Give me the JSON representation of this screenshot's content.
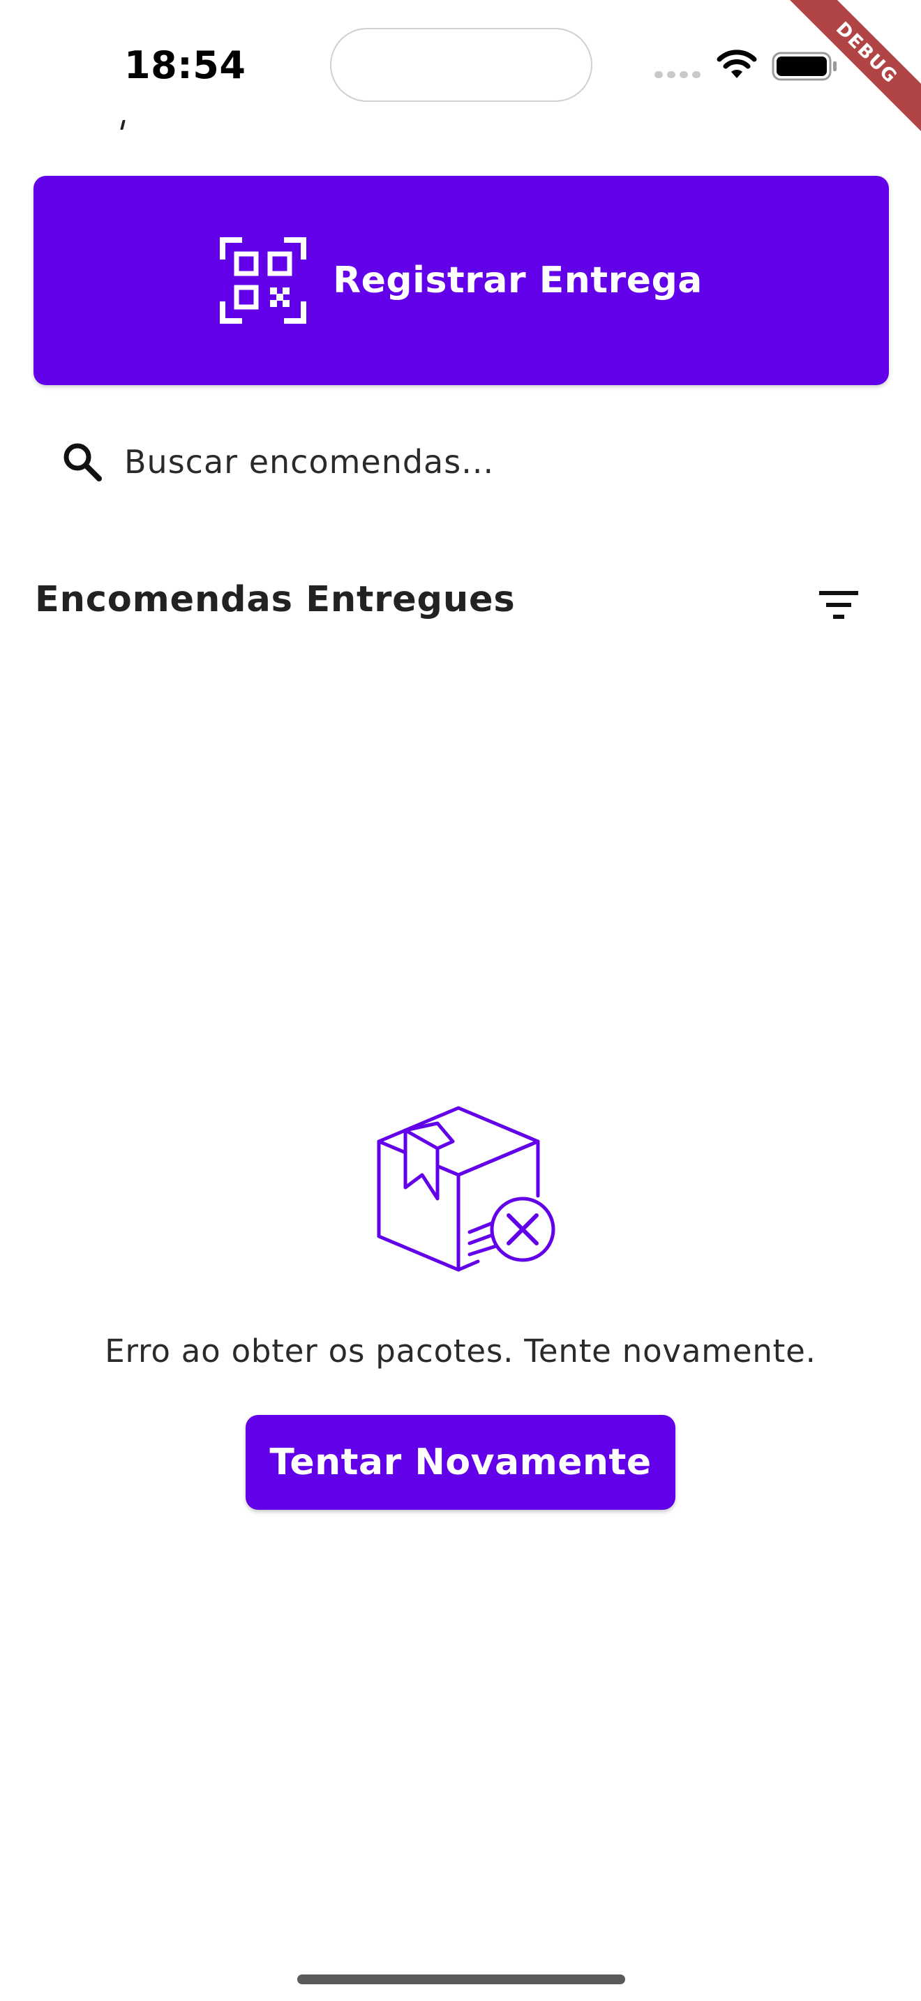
{
  "status_bar": {
    "time": "18:54",
    "wifi_icon": "wifi-icon",
    "battery_icon": "battery-icon"
  },
  "debug_banner": {
    "label": "DEBUG",
    "color": "#b14545"
  },
  "register_button": {
    "label": "Registrar Entrega",
    "icon": "qr-code-scan-icon",
    "color": "#6200ea"
  },
  "search": {
    "placeholder": "Buscar encomendas...",
    "value": "",
    "icon": "search-icon"
  },
  "section": {
    "title": "Encomendas Entregues",
    "filter_icon": "filter-icon"
  },
  "error_state": {
    "icon": "package-error-icon",
    "message": "Erro ao obter os pacotes. Tente novamente.",
    "retry_label": "Tentar Novamente",
    "accent_color": "#6200ea"
  }
}
